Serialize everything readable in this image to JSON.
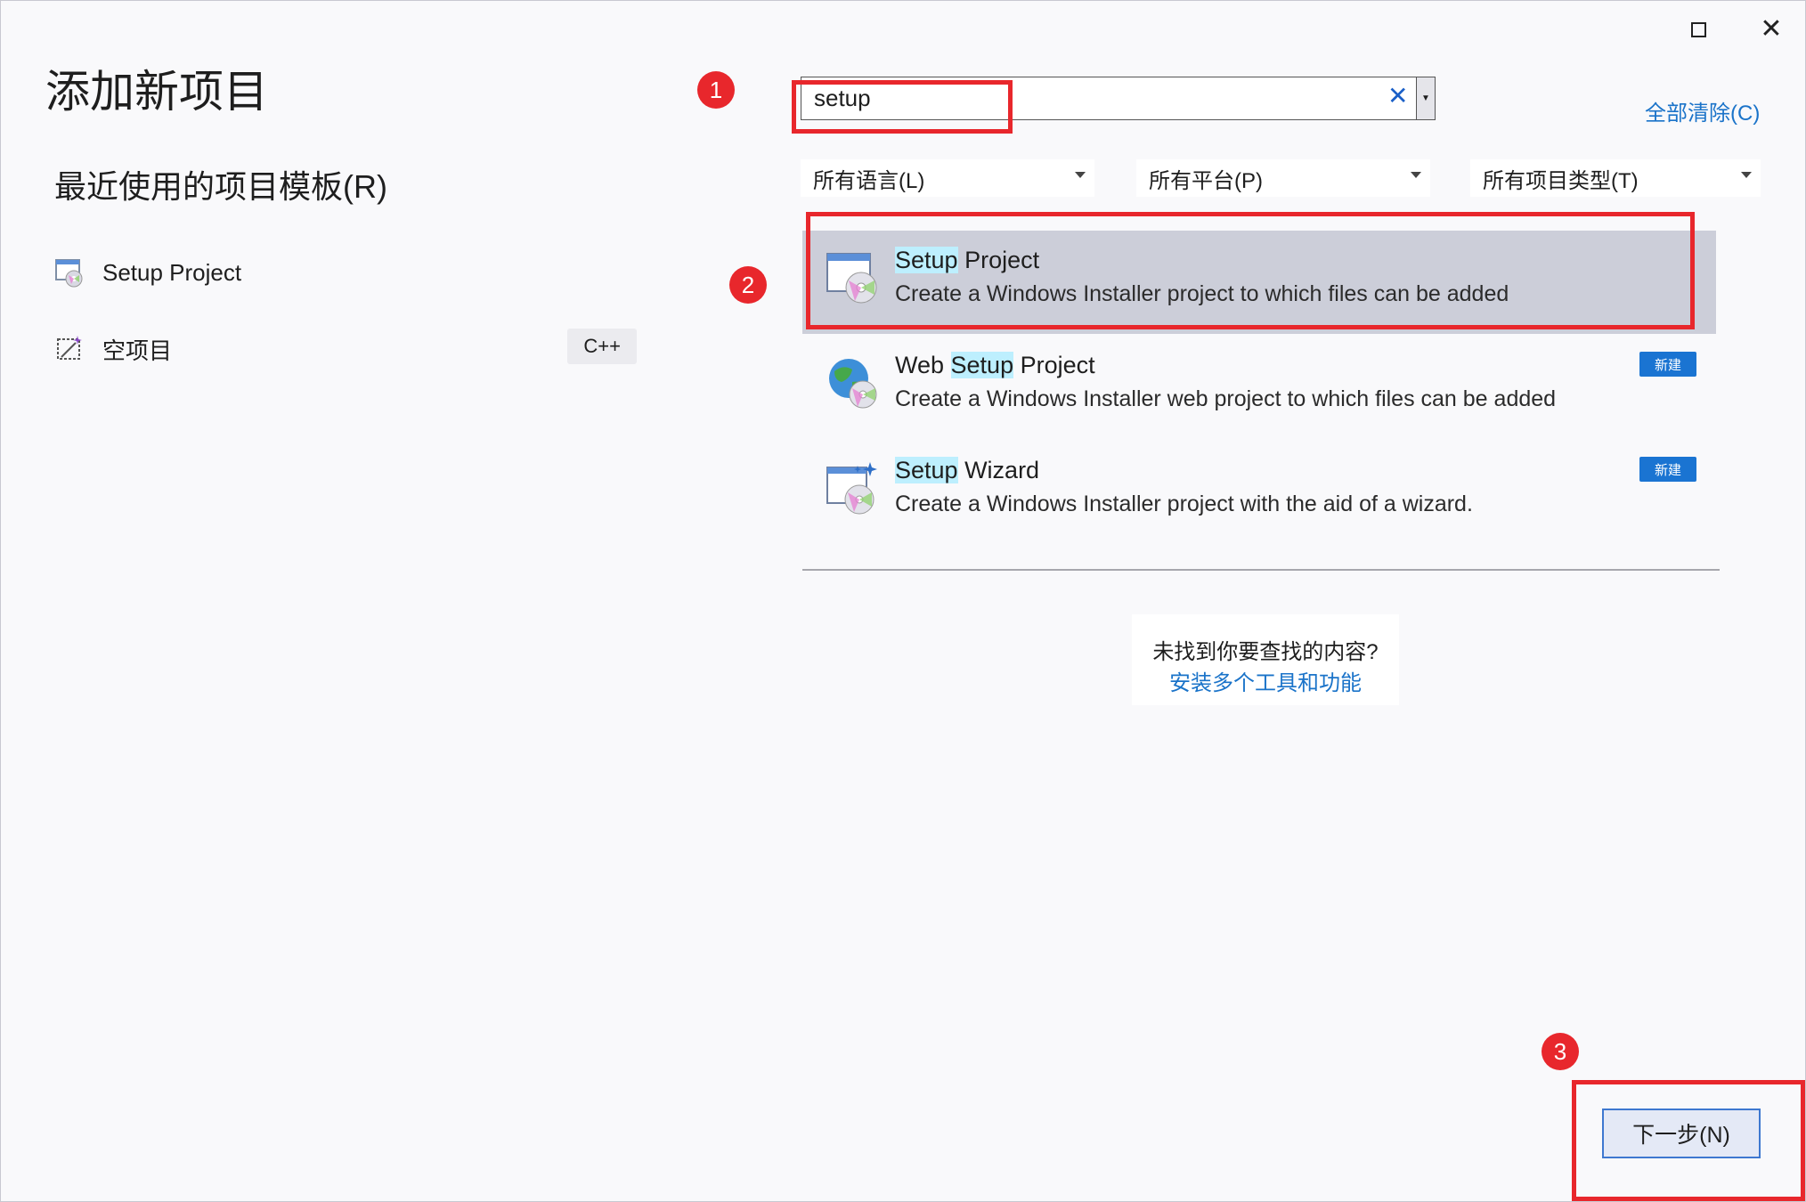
{
  "window": {
    "title": "添加新项目",
    "maximize_icon": "maximize-icon",
    "close_icon": "close-icon"
  },
  "recent": {
    "heading": "最近使用的项目模板(R)",
    "items": [
      {
        "label": "Setup Project",
        "icon": "setup-project-icon",
        "tag": ""
      },
      {
        "label": "空项目",
        "icon": "empty-project-icon",
        "tag": "C++"
      }
    ]
  },
  "search": {
    "value": "setup",
    "placeholder": "",
    "clear_icon": "clear-icon",
    "dropdown_icon": "dropdown-arrow-icon",
    "clear_all": "全部清除(C)"
  },
  "filters": [
    {
      "label": "所有语言(L)"
    },
    {
      "label": "所有平台(P)"
    },
    {
      "label": "所有项目类型(T)"
    }
  ],
  "results": [
    {
      "name_highlight": "Setup",
      "name_rest": " Project",
      "name_prefix": "",
      "description": "Create a Windows Installer project to which files can be added",
      "selected": true,
      "badge": ""
    },
    {
      "name_prefix": "Web ",
      "name_highlight": "Setup",
      "name_rest": " Project",
      "description": "Create a Windows Installer web project to which files can be added",
      "selected": false,
      "badge": "新建"
    },
    {
      "name_prefix": "",
      "name_highlight": "Setup",
      "name_rest": " Wizard",
      "description": "Create a Windows Installer project with the aid of a wizard.",
      "selected": false,
      "badge": "新建"
    }
  ],
  "not_found": {
    "question": "未找到你要查找的内容?",
    "link": "安装多个工具和功能"
  },
  "annotations": {
    "badge1": "1",
    "badge2": "2",
    "badge3": "3",
    "color": "#e8272c"
  },
  "footer": {
    "next_button": "下一步(N)"
  }
}
